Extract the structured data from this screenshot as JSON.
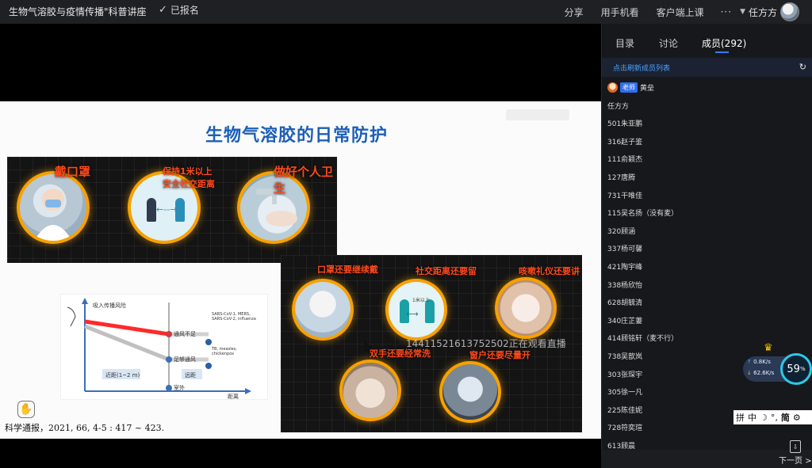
{
  "topbar": {
    "course_title": "生物气溶胶与疫情传播\"科普讲座",
    "registered_label": "已报名",
    "share_label": "分享",
    "mobile_label": "用手机看",
    "client_label": "客户端上课",
    "more_label": "···",
    "user_name": "任方方"
  },
  "slide": {
    "title": "生物气溶胶的日常防护",
    "labels": {
      "mask": "戴口罩",
      "distance": "保持1米以上安全社交距离",
      "hygiene": "做好个人卫生",
      "mask_keep": "口罩还要继续戴",
      "social_keep": "社交距离还要留",
      "cough_keep": "咳嗽礼仪还要讲",
      "hands_keep": "双手还要经常洗",
      "window_keep": "窗户还要尽量开",
      "one_meter": "1米以上"
    },
    "graph": {
      "y_label": "吸入传播风险",
      "x_label": "距离",
      "poor_vent": "通风不足",
      "good_vent": "足够通风",
      "outdoor": "室外",
      "near": "近距(1~2 m)",
      "far": "远距",
      "sars_note": "SARS-CoV-1, MERS, SARS-CoV-2, influenza",
      "tb_note": "TB, measles, chickenpox"
    },
    "citation": "科学通报，2021, 66, 4-5 : 417 ~ 423."
  },
  "overlay": {
    "live_watch": "14411521613752502正在观看直播"
  },
  "side": {
    "tabs": {
      "catalog": "目录",
      "discuss": "讨论",
      "members": "成员(292)"
    },
    "refresh_link": "点击刷新成员列表",
    "members": [
      {
        "name": "黄垒",
        "teacher": "老师"
      },
      {
        "name": "任方方"
      },
      {
        "name": "501朱亚鹏"
      },
      {
        "name": "316赵子鉴"
      },
      {
        "name": "111俞颖杰"
      },
      {
        "name": "127唐腾"
      },
      {
        "name": "731干唯佳"
      },
      {
        "name": "115吴名扬（没有麦）"
      },
      {
        "name": "320顾涵"
      },
      {
        "name": "337杨可馨"
      },
      {
        "name": "421陶宇峰"
      },
      {
        "name": "338杨欣怡"
      },
      {
        "name": "628胡毓清"
      },
      {
        "name": "340庄芷萋"
      },
      {
        "name": "414顾铭轩（麦不行）"
      },
      {
        "name": "738吴歆岚"
      },
      {
        "name": "303张琛宇"
      },
      {
        "name": "305徐一凡"
      },
      {
        "name": "225陈佳妮"
      },
      {
        "name": "728符奕瑄"
      },
      {
        "name": "613顾晨"
      }
    ],
    "next_page": "下一页"
  },
  "network": {
    "up": "0.8K/s",
    "down": "62.6K/s",
    "percent": "59",
    "percent_sign": "%"
  },
  "ime": {
    "grid": "拼",
    "mode": "中",
    "moon": "☽",
    "punct": "°,",
    "simp": "简",
    "gear": "⚙"
  },
  "colors": {
    "accent": "#2f7ff5",
    "title_blue": "#1c5fb7",
    "ring": "#f7a100",
    "red_label": "#ff4a1c"
  }
}
